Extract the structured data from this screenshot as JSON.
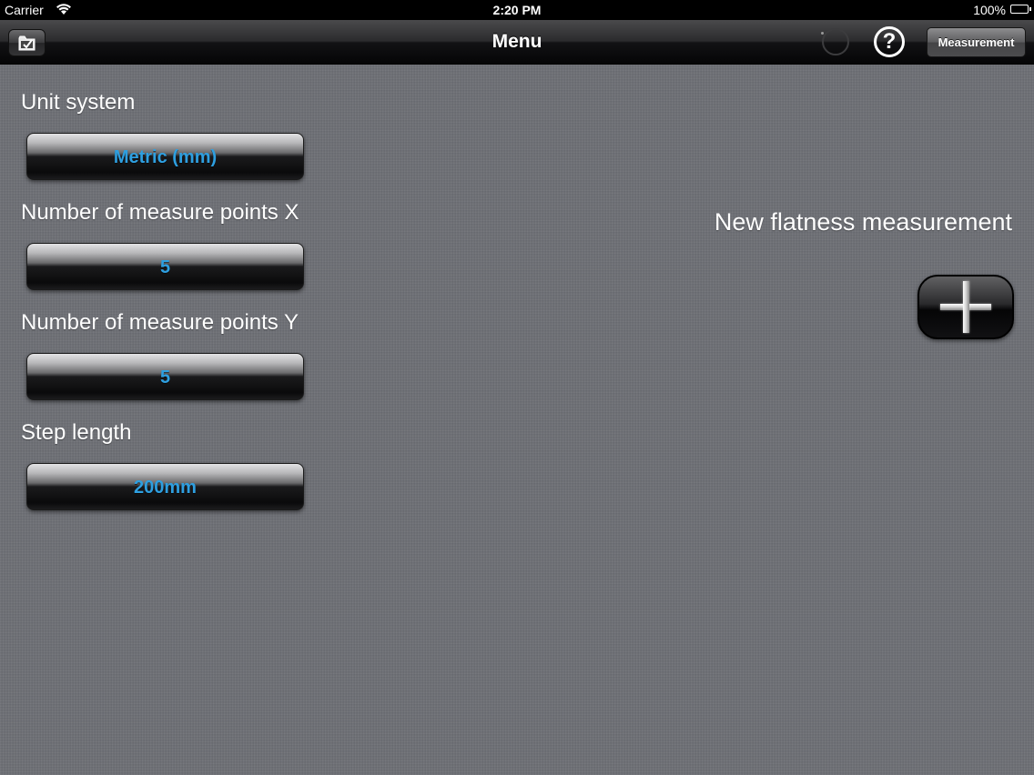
{
  "status_bar": {
    "carrier": "Carrier",
    "time": "2:20 PM",
    "battery": "100%",
    "wifi_icon": "wifi-icon",
    "battery_icon": "battery-icon"
  },
  "nav": {
    "title": "Menu",
    "left_icon": "folder-icon",
    "help_label": "?",
    "measurement_label": "Measurement"
  },
  "settings": [
    {
      "label": "Unit system",
      "value": "Metric (mm)"
    },
    {
      "label": "Number of measure points X",
      "value": "5"
    },
    {
      "label": "Number of measure points Y",
      "value": "5"
    },
    {
      "label": "Step length",
      "value": "200mm"
    }
  ],
  "new_measurement": {
    "label": "New flatness measurement",
    "icon": "plus-icon"
  },
  "colors": {
    "value_text": "#2e9fe0",
    "background": "#6c6e74"
  }
}
